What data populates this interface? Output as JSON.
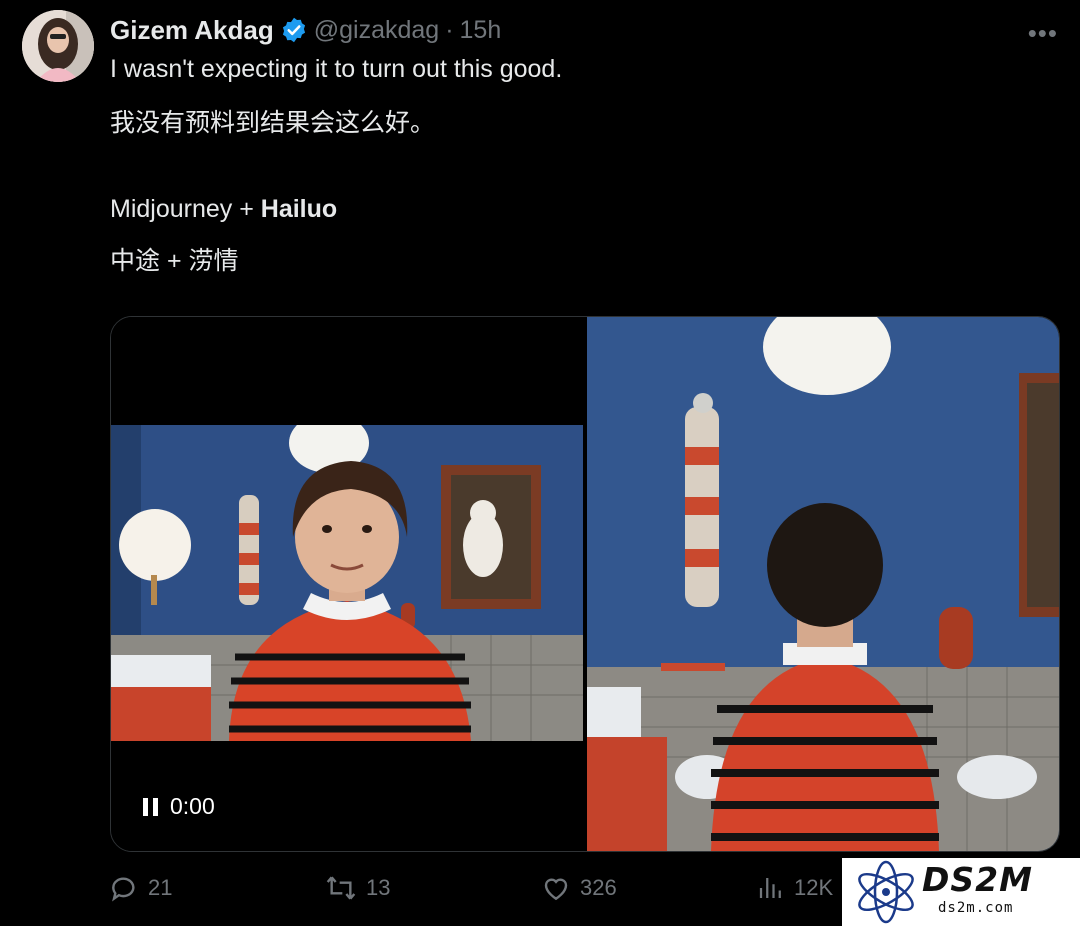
{
  "post": {
    "author_name": "Gizem Akdag",
    "handle": "@gizakdag",
    "separator": "·",
    "time": "15h",
    "more_label": "•••",
    "lines": [
      "I wasn't expecting it to turn out this good.",
      "我没有预料到结果会这么好。"
    ],
    "tools_prefix": "Midjourney + ",
    "tools_bold": "Hailuo",
    "tools_cn": "中途 + 涝情"
  },
  "video": {
    "timestamp": "0:00",
    "state": "playing"
  },
  "actions": {
    "replies": "21",
    "reposts": "13",
    "likes": "326",
    "views": "12K"
  },
  "watermark": {
    "title": "DS2M",
    "subtitle": "ds2m.com"
  },
  "icons": {
    "verified": "verified-badge-icon",
    "reply": "reply-icon",
    "repost": "repost-icon",
    "like": "heart-icon",
    "views": "bar-chart-icon",
    "pause": "pause-icon"
  },
  "colors": {
    "verified": "#1d9bf0",
    "secondary": "#71767b",
    "text": "#e7e9ea"
  }
}
